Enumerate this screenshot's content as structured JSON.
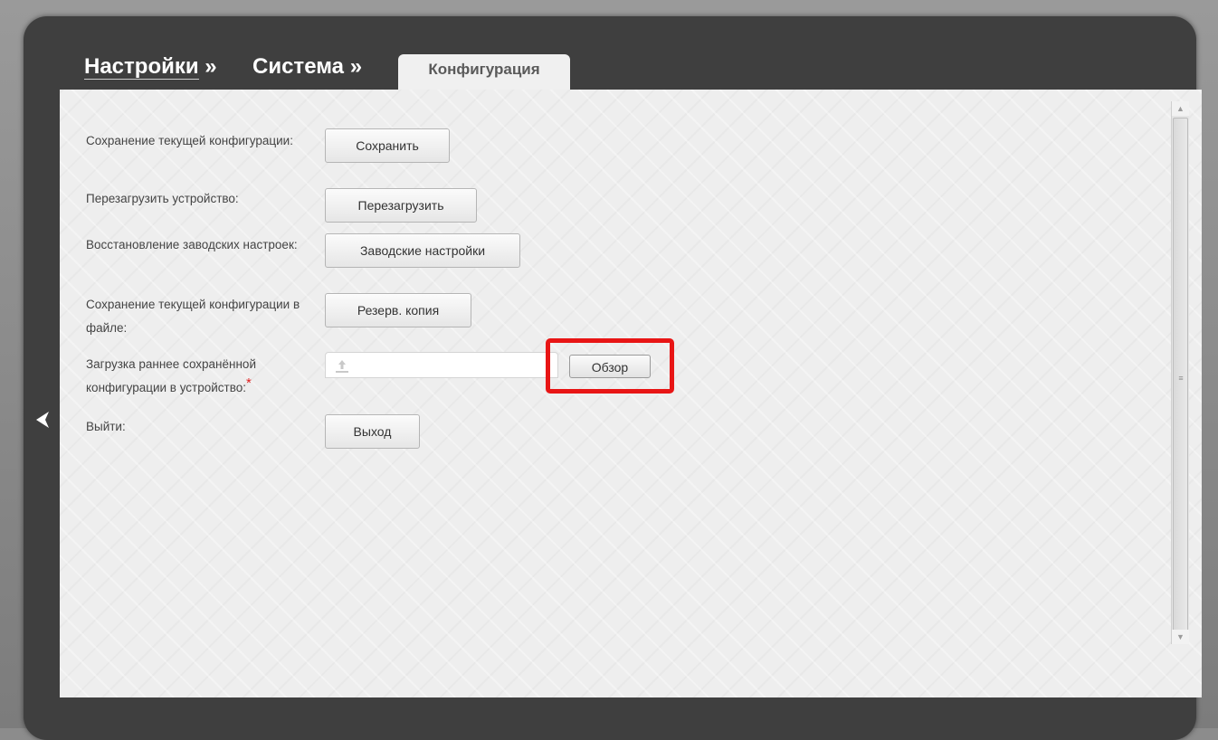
{
  "breadcrumb": {
    "settings": "Настройки",
    "system": "Система",
    "separator": "»"
  },
  "tab": {
    "label": "Конфигурация"
  },
  "rows": [
    {
      "label": "Сохранение текущей конфигурации:",
      "button": "Сохранить"
    },
    {
      "label": "Перезагрузить устройство:",
      "button": "Перезагрузить"
    },
    {
      "label": "Восстановление заводских настроек:",
      "button": "Заводские настройки"
    },
    {
      "label": "Сохранение текущей конфигурации в файле:",
      "button": "Резерв. копия"
    },
    {
      "label": "Загрузка раннее сохранённой конфигурации в устройство:",
      "required_mark": "*",
      "button": "Обзор"
    },
    {
      "label": "Выйти:",
      "button": "Выход"
    }
  ],
  "file_input": {
    "value": "",
    "icon": "upload-icon"
  },
  "icons": {
    "back": "chevron-left-icon",
    "scroll_grip": "grip-lines-icon"
  },
  "colors": {
    "frame": "#3f3f3f",
    "content_bg": "#eeeeee",
    "highlight": "#e81515",
    "required": "#e02020"
  }
}
